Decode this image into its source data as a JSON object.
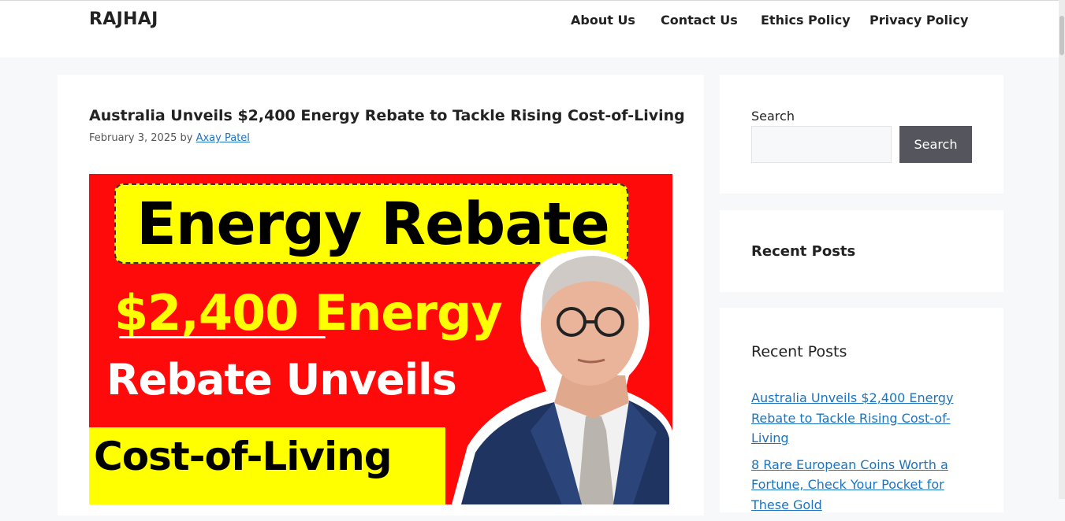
{
  "site": {
    "title": "RAJHAJ"
  },
  "nav": [
    {
      "label": "About Us"
    },
    {
      "label": "Contact Us"
    },
    {
      "label": "Ethics Policy"
    },
    {
      "label": "Privacy Policy"
    }
  ],
  "post": {
    "title": "Australia Unveils $2,400 Energy Rebate to Tackle Rising Cost-of-Living",
    "date": "February 3, 2025",
    "by": "by",
    "author": "Axay Patel",
    "image": {
      "line1": "Energy Rebate",
      "line2": "$2,400 Energy",
      "line3": "Rebate Unveils",
      "line4": "Cost-of-Living",
      "bg_color": "#ff0a0a",
      "accent_color": "#ffff00"
    }
  },
  "sidebar": {
    "search": {
      "label": "Search",
      "value": "",
      "button": "Search"
    },
    "recent_heading_1": "Recent Posts",
    "recent_heading_2": "Recent Posts",
    "recent_posts": [
      "Australia Unveils $2,400 Energy Rebate to Tackle Rising Cost-of-Living",
      "8 Rare European Coins Worth a Fortune, Check Your Pocket for These Gold"
    ]
  },
  "colors": {
    "link": "#1e73be",
    "button": "#55555e",
    "page_bg": "#f7f8f9"
  }
}
